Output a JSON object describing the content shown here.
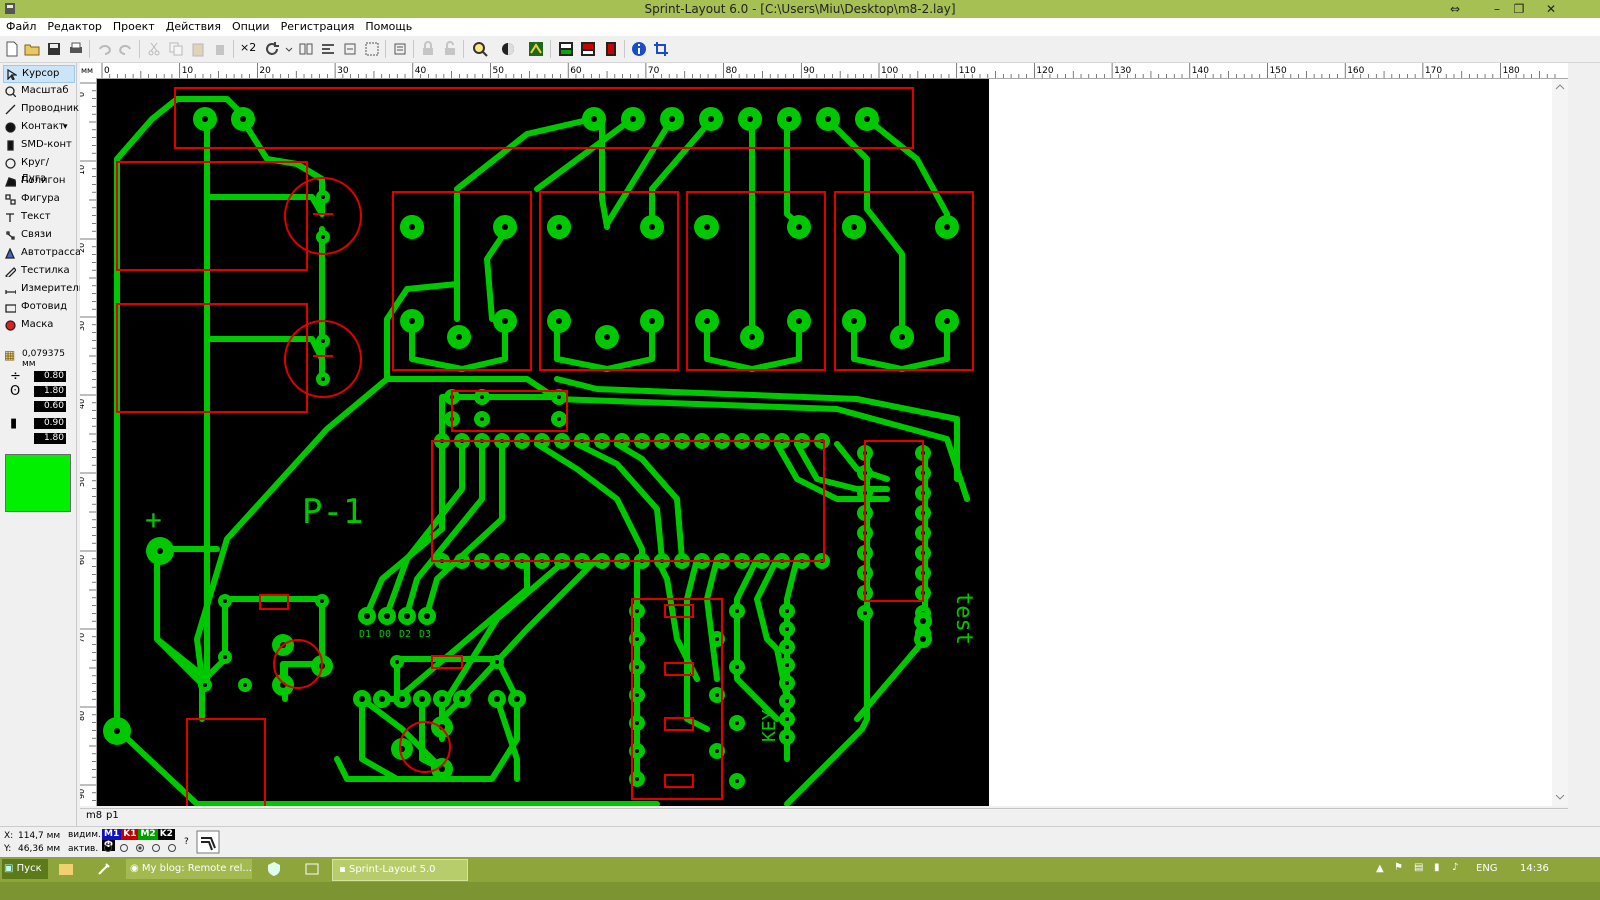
{
  "window": {
    "title": "Sprint-Layout 6.0 - [C:\\Users\\Miu\\Desktop\\m8-2.lay]"
  },
  "menu": [
    "Файл",
    "Редактор",
    "Проект",
    "Действия",
    "Опции",
    "Регистрация",
    "Помощь"
  ],
  "toolbar": {
    "icons": [
      "new-file-icon",
      "open-icon",
      "save-icon",
      "print-icon",
      "undo-icon",
      "redo-icon",
      "cut-icon",
      "copy-icon",
      "paste-icon",
      "delete-icon",
      "duplicate-icon",
      "rotate-icon",
      "mirror-icon",
      "align-icon",
      "arrange-icon",
      "group-icon",
      "properties-icon",
      "lock-icon",
      "unlock-icon",
      "zoom-icon",
      "view-icon",
      "pcb-icon",
      "drc-icon",
      "gerber-icon",
      "macro-icon",
      "info-icon",
      "crop-icon"
    ],
    "dup_label": "×2"
  },
  "tools": [
    {
      "label": "Курсор",
      "icon": "cursor-icon",
      "selected": true
    },
    {
      "label": "Масштаб",
      "icon": "zoom-icon"
    },
    {
      "label": "Проводник",
      "icon": "track-icon"
    },
    {
      "label": "Контакт",
      "icon": "pad-icon"
    },
    {
      "label": "SMD-конт",
      "icon": "smd-pad-icon"
    },
    {
      "label": "Круг/Дуга",
      "icon": "circle-icon"
    },
    {
      "label": "Полигон",
      "icon": "polygon-icon"
    },
    {
      "label": "Фигура",
      "icon": "shape-icon"
    },
    {
      "label": "Текст",
      "icon": "text-icon"
    },
    {
      "label": "Связи",
      "icon": "connections-icon"
    },
    {
      "label": "Автотрасса",
      "icon": "autoroute-icon"
    },
    {
      "label": "Тестилка",
      "icon": "tester-icon"
    },
    {
      "label": "Измеритель",
      "icon": "measure-icon"
    },
    {
      "label": "Фотовид",
      "icon": "photoview-icon"
    },
    {
      "label": "Маска",
      "icon": "mask-icon"
    }
  ],
  "grid": {
    "value": "0,079375 мм"
  },
  "params": {
    "track_width": "0.80",
    "pad_outer": "1.80",
    "pad_inner": "0.60",
    "smd_w": "0.90",
    "smd_h": "1.80"
  },
  "colors": {
    "copper": "#00c800",
    "active_color": "#00f000",
    "outline": "#e00000",
    "board_bg": "#000000",
    "titlebar": "#a7c054",
    "taskbar": "#8da53b"
  },
  "ruler": {
    "unit": "мм",
    "top_labels": [
      "0",
      "10",
      "20",
      "30",
      "40",
      "50",
      "60",
      "70",
      "80",
      "90",
      "100",
      "110",
      "120",
      "130",
      "140",
      "150",
      "160",
      "170",
      "180"
    ],
    "left_labels": [
      "0",
      "10",
      "20",
      "30",
      "40",
      "50",
      "60",
      "70",
      "80",
      "90"
    ]
  },
  "board_text": {
    "label1": "P-1",
    "plus": "+",
    "test": "test",
    "key": "KEY",
    "pins": [
      "D1",
      "D0",
      "D2",
      "D3"
    ]
  },
  "layers": {
    "tab1": "m8",
    "tab2": "p1"
  },
  "status": {
    "x_label": "X:",
    "x": "114,7 мм",
    "y_label": "Y:",
    "y": "46,36 мм",
    "visible": "видим.",
    "active": "актив.",
    "layer_chips": [
      {
        "name": "M1",
        "color": "#1010c0"
      },
      {
        "name": "K1",
        "color": "#c00000"
      },
      {
        "name": "M2",
        "color": "#00a000"
      },
      {
        "name": "K2",
        "color": "#000000"
      },
      {
        "name": "Ф",
        "color": "#000000"
      }
    ],
    "help": "?"
  },
  "taskbar": {
    "start": "Пуск",
    "tasks": [
      "My blog: Remote rel...",
      "Sprint-Layout 5.0"
    ],
    "lang": "ENG",
    "time": "14:36"
  }
}
